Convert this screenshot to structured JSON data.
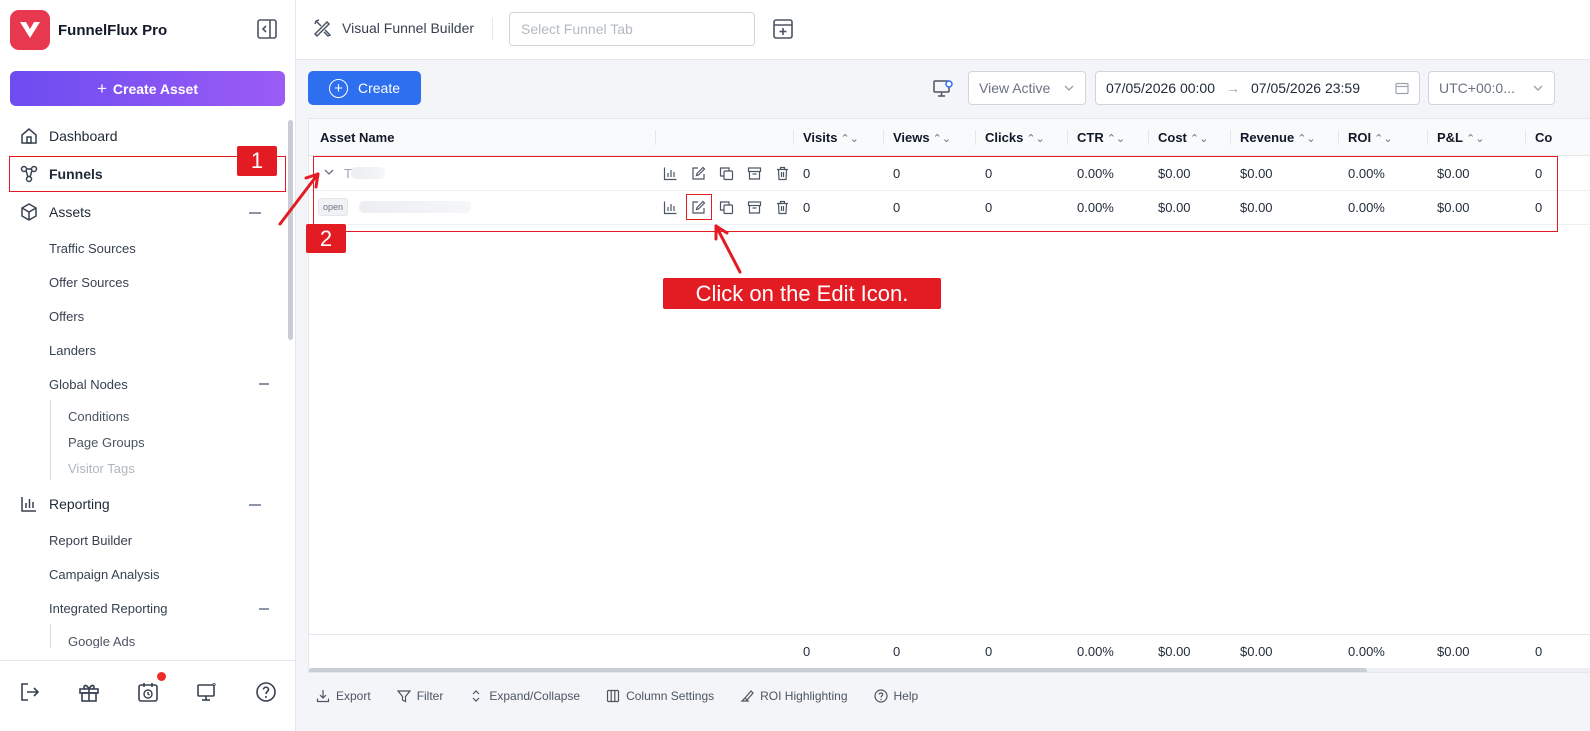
{
  "app": {
    "name": "FunnelFlux Pro",
    "create_asset_label": "Create Asset",
    "create_asset_plus": "+"
  },
  "sidebar": {
    "nav": {
      "dashboard": "Dashboard",
      "funnels": "Funnels",
      "assets": "Assets",
      "reporting": "Reporting"
    },
    "assets_children": [
      "Traffic Sources",
      "Offer Sources",
      "Offers",
      "Landers",
      "Global Nodes"
    ],
    "global_nodes_children": [
      "Conditions",
      "Page Groups",
      "Visitor Tags"
    ],
    "reporting_children": [
      "Report Builder",
      "Campaign Analysis",
      "Integrated Reporting"
    ],
    "integrated_children": [
      "Google Ads"
    ],
    "notification_color": "#ef2b2b"
  },
  "topbar": {
    "builder_label": "Visual Funnel Builder",
    "tab_select_placeholder": "Select Funnel Tab"
  },
  "toolbar": {
    "create_label": "Create",
    "view_filter": "View Active",
    "date_from": "07/05/2026 00:00",
    "date_to": "07/05/2026 23:59",
    "date_arrow": "→",
    "timezone": "UTC+00:0..."
  },
  "table": {
    "columns": {
      "asset_name": "Asset Name",
      "visits": "Visits",
      "views": "Views",
      "clicks": "Clicks",
      "ctr": "CTR",
      "cost": "Cost",
      "revenue": "Revenue",
      "roi": "ROI",
      "pl": "P&L",
      "conv": "Co"
    },
    "sort_icon": "⌃⌄",
    "rows": [
      {
        "name": "T",
        "tag": "",
        "visits": "0",
        "views": "0",
        "clicks": "0",
        "ctr": "0.00%",
        "cost": "$0.00",
        "revenue": "$0.00",
        "roi": "0.00%",
        "pl": "$0.00",
        "conv": "0"
      },
      {
        "name": "",
        "tag": "open",
        "visits": "0",
        "views": "0",
        "clicks": "0",
        "ctr": "0.00%",
        "cost": "$0.00",
        "revenue": "$0.00",
        "roi": "0.00%",
        "pl": "$0.00",
        "conv": "0"
      }
    ],
    "totals": {
      "visits": "0",
      "views": "0",
      "clicks": "0",
      "ctr": "0.00%",
      "cost": "$0.00",
      "revenue": "$0.00",
      "roi": "0.00%",
      "pl": "$0.00",
      "conv": "0"
    }
  },
  "bottom_tools": [
    "Export",
    "Filter",
    "Expand/Collapse",
    "Column Settings",
    "ROI Highlighting",
    "Help"
  ],
  "annotations": {
    "step1": "1",
    "step2": "2",
    "callout": "Click on the Edit Icon.",
    "color": "#e31b23"
  }
}
